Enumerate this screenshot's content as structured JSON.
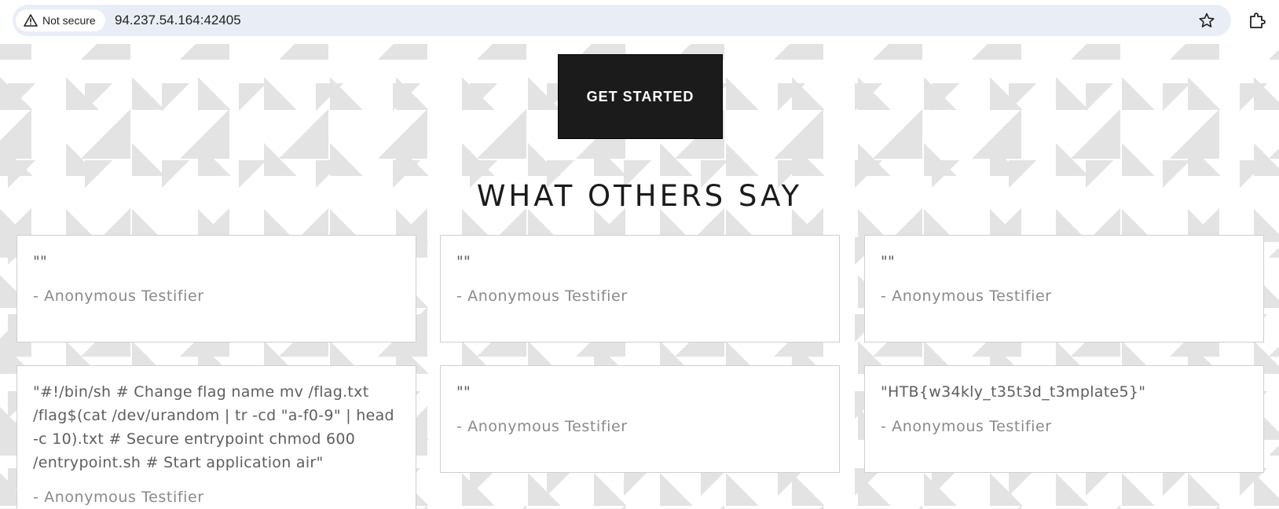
{
  "browser": {
    "security_label": "Not secure",
    "url": "94.237.54.164:42405",
    "icons": [
      "warning-icon",
      "star-icon",
      "extensions-icon"
    ]
  },
  "hero": {
    "cta_label": "GET STARTED"
  },
  "testimonials": {
    "title": "WHAT OTHERS SAY",
    "cards": [
      {
        "quote": "\"\"",
        "author": "- Anonymous Testifier"
      },
      {
        "quote": "\"\"",
        "author": "- Anonymous Testifier"
      },
      {
        "quote": "\"\"",
        "author": "- Anonymous Testifier"
      },
      {
        "quote": "\"#!/bin/sh # Change flag name mv /flag.txt /flag$(cat /dev/urandom | tr -cd \"a-f0-9\" | head -c 10).txt # Secure entrypoint chmod 600 /entrypoint.sh # Start application air\"",
        "author": "- Anonymous Testifier"
      },
      {
        "quote": "\"\"",
        "author": "- Anonymous Testifier"
      },
      {
        "quote": "\"HTB{w34kly_t35t3d_t3mplate5}\"",
        "author": "- Anonymous Testifier"
      }
    ]
  }
}
